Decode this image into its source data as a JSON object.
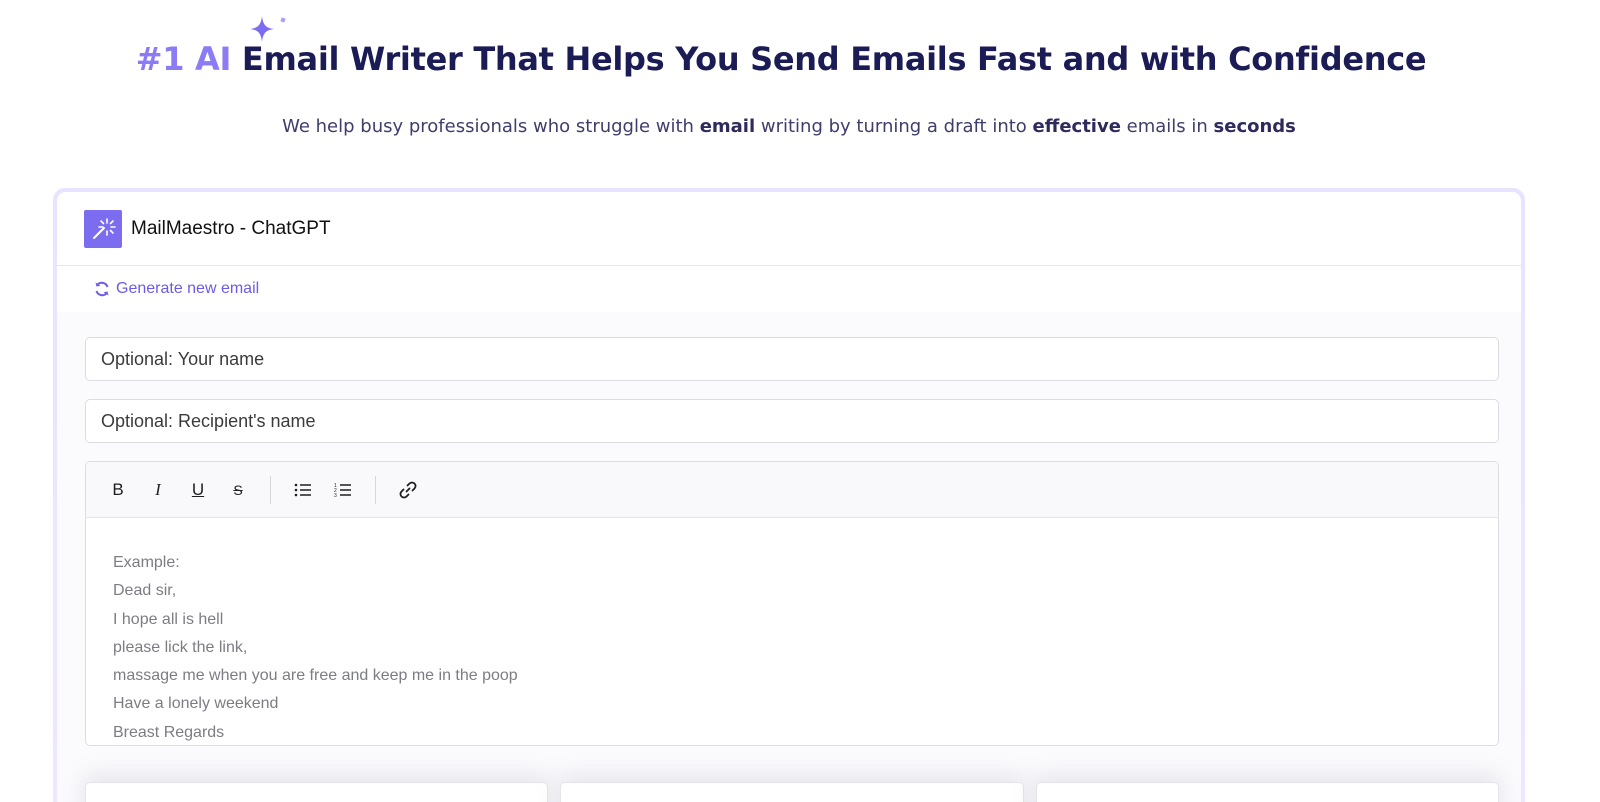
{
  "hero": {
    "title_accent": "#1 AI",
    "title_rest": " Email Writer That Helps You Send Emails Fast and with Confidence",
    "subtitle_parts": {
      "p1": "We help busy professionals who struggle with ",
      "b1": "email",
      "p2": " writing by turning a draft into ",
      "b2": "effective",
      "p3": " emails in ",
      "b3": "seconds"
    }
  },
  "app": {
    "title": "MailMaestro - ChatGPT",
    "generate_label": "Generate new email",
    "your_name_placeholder": "Optional: Your name",
    "recipient_placeholder": "Optional: Recipient's name"
  },
  "toolbar": {
    "bold": "B",
    "italic": "I",
    "underline": "U",
    "strike": "S"
  },
  "editor": {
    "lines": [
      "Example:",
      "Dead sir,",
      "I hope all is hell",
      "please lick the link,",
      "massage me when you are free and keep me in the poop",
      "Have a lonely weekend",
      "Breast Regards"
    ]
  },
  "colors": {
    "accent": "#8b7cf6",
    "brand": "#7c6cf0",
    "link": "#6d5be8",
    "heading": "#1b1b55"
  },
  "icons": {
    "sparkle": "sparkle-icon",
    "logo": "magic-wand-icon",
    "refresh": "refresh-icon",
    "bullet_list": "bullet-list-icon",
    "numbered_list": "numbered-list-icon",
    "link": "link-icon"
  }
}
